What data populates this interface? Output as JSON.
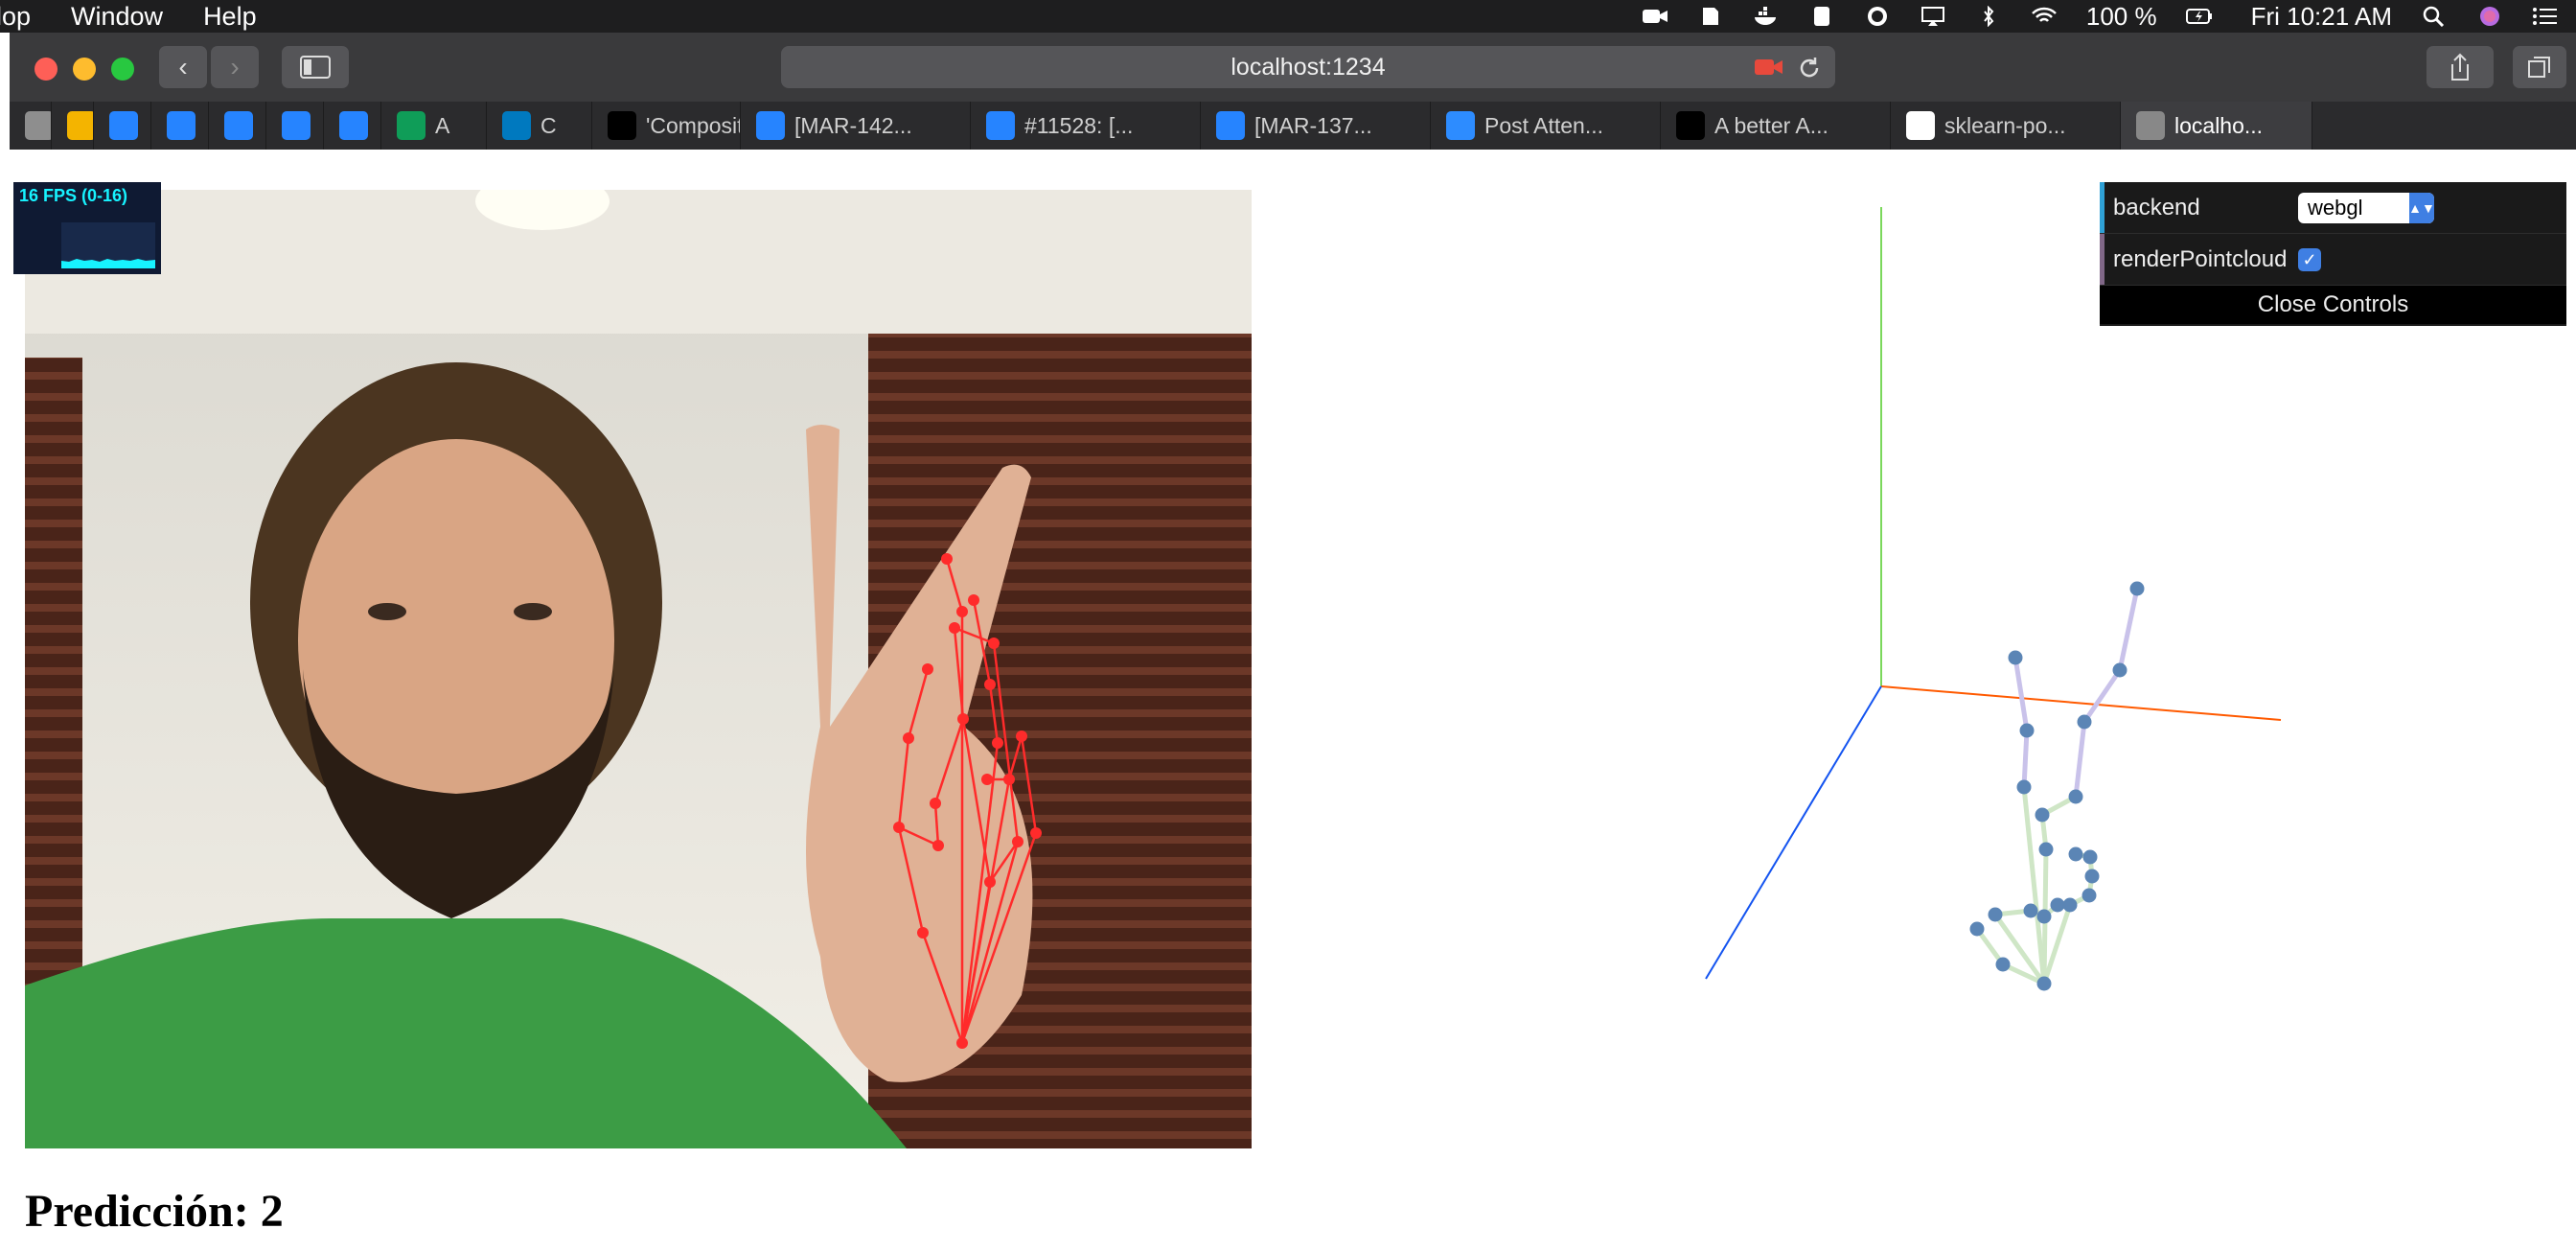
{
  "menubar": {
    "items": [
      "lop",
      "Window",
      "Help"
    ],
    "battery": "100 %",
    "clock": "Fri 10:21 AM"
  },
  "browser": {
    "url": "localhost:1234",
    "tabs": [
      {
        "label": "",
        "icon": "google-icon",
        "color": "#8e8e8e"
      },
      {
        "label": "",
        "icon": "slides-icon",
        "color": "#f4b400"
      },
      {
        "label": "",
        "icon": "jira-icon",
        "color": "#2684ff"
      },
      {
        "label": "",
        "icon": "jira-icon",
        "color": "#2684ff"
      },
      {
        "label": "",
        "icon": "jira-icon",
        "color": "#2684ff"
      },
      {
        "label": "",
        "icon": "bitbucket-icon",
        "color": "#2684ff"
      },
      {
        "label": "",
        "icon": "bitbucket-icon",
        "color": "#2684ff"
      },
      {
        "label": "A",
        "icon": "sheets-icon",
        "color": "#0f9d58"
      },
      {
        "label": "C",
        "icon": "trello-icon",
        "color": "#0079bf"
      },
      {
        "label": "'Composit...",
        "icon": "medium-icon",
        "color": "#000000"
      },
      {
        "label": "[MAR-142...",
        "icon": "jira-icon",
        "color": "#2684ff"
      },
      {
        "label": "#11528: [...",
        "icon": "bitbucket-icon",
        "color": "#2684ff"
      },
      {
        "label": "[MAR-137...",
        "icon": "jira-icon",
        "color": "#2684ff"
      },
      {
        "label": "Post Atten...",
        "icon": "zoom-icon",
        "color": "#2d8cff"
      },
      {
        "label": "A better A...",
        "icon": "medium-icon",
        "color": "#000000"
      },
      {
        "label": "sklearn-po...",
        "icon": "github-icon",
        "color": "#ffffff"
      },
      {
        "label": "localho...",
        "icon": "camera-icon",
        "color": "#888888"
      }
    ]
  },
  "fps": {
    "label": "16 FPS (0-16)",
    "color": "#17f3ff"
  },
  "controls": {
    "backend_label": "backend",
    "backend_value": "webgl",
    "pointcloud_label": "renderPointcloud",
    "pointcloud_checked": true,
    "close_label": "Close Controls"
  },
  "prediction": "Predicción: 2",
  "colors": {
    "landmark": "#ff2b2b",
    "point3d": "#5b85b5",
    "axis_x": "#ff5a00",
    "axis_y": "#7bd85c",
    "axis_z": "#1454f0"
  }
}
